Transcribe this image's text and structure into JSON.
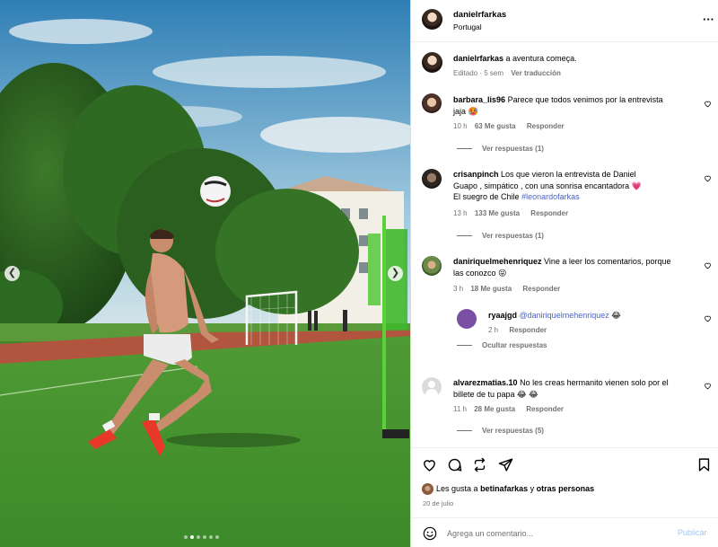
{
  "post": {
    "username": "danielrfarkas",
    "location": "Portugal",
    "more_icon": "more-horizontal-icon"
  },
  "caption": {
    "username": "danielrfarkas",
    "text": "a aventura começa.",
    "edited": "Editado · 5 sem",
    "translate": "Ver traducción"
  },
  "comments": [
    {
      "username": "barbara_lis96",
      "text_line1": "Parece que todos venimos por la entrevista",
      "text_line2": "jaja 🥵",
      "time": "10 h",
      "likes": "63 Me gusta",
      "reply": "Responder",
      "view_replies": "Ver respuestas (1)"
    },
    {
      "username": "crisanpinch",
      "text_line1": "Los que vieron la entrevista de Daniel",
      "text_line2": "Guapo , simpático , con una sonrisa encantadora 💗",
      "text_line3": "El suegro de Chile",
      "hashtag": "#leonardofarkas",
      "time": "13 h",
      "likes": "133 Me gusta",
      "reply": "Responder",
      "view_replies": "Ver respuestas (1)"
    },
    {
      "username": "daniriquelmehenriquez",
      "text_line1": "Vine a leer los comentarios, porque",
      "text_line2": "las conozco 😜",
      "time": "3 h",
      "likes": "18 Me gusta",
      "reply": "Responder",
      "reply_item": {
        "username": "ryaajgd",
        "mention": "@daniriquelmehenriquez",
        "emoji": "😂",
        "time": "2 h",
        "reply": "Responder"
      },
      "hide_replies": "Ocultar respuestas"
    },
    {
      "username": "alvarezmatias.10",
      "text_line1": "No les creas hermanito vienen solo por el",
      "text_line2": "billete de tu papa 😂 😂",
      "time": "11 h",
      "likes": "28 Me gusta",
      "reply": "Responder",
      "view_replies": "Ver respuestas (5)"
    }
  ],
  "actions": {
    "like_icon": "heart-icon",
    "comment_icon": "comment-icon",
    "repost_icon": "repost-icon",
    "share_icon": "share-icon",
    "save_icon": "bookmark-icon"
  },
  "likes_line": {
    "prefix": "Les gusta a",
    "user": "betinafarkas",
    "middle": "y",
    "others": "otras personas"
  },
  "date": "20 de julio",
  "add_comment": {
    "placeholder": "Agrega un comentario...",
    "publish": "Publicar",
    "emoji_icon": "emoji-icon"
  },
  "carousel": {
    "prev_icon": "chevron-left-icon",
    "next_icon": "chevron-right-icon",
    "dots": 6,
    "active_dot": 2
  },
  "colors": {
    "link": "#4b62c9",
    "muted": "#737373",
    "publish": "#9fc6f3"
  }
}
